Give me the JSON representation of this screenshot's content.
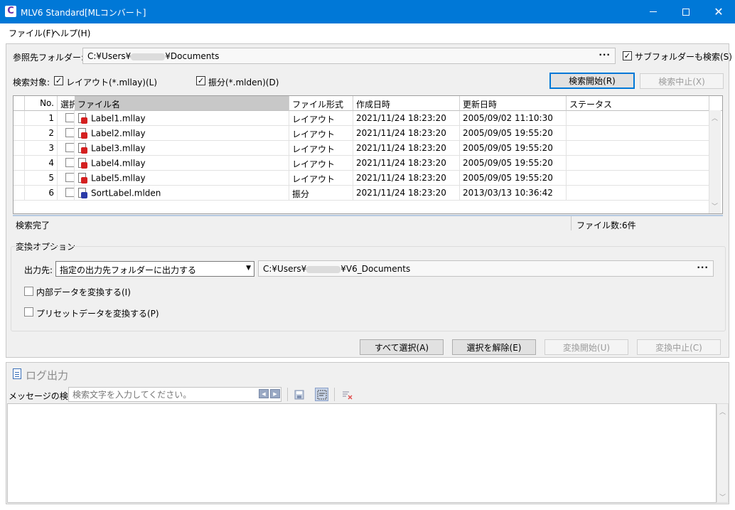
{
  "window": {
    "title": "MLV6 Standard[MLコンバート]",
    "app_icon_letter": "C"
  },
  "menu": {
    "items": [
      "ファイル(F)",
      "ヘルプ(H)"
    ]
  },
  "ref_folder": {
    "label": "参照先フォルダー:",
    "path_prefix": "C:¥Users¥",
    "path_suffix": "¥Documents",
    "browse": "···",
    "subfolder_label": "サブフォルダーも検索(S)",
    "subfolder_checked": true
  },
  "search_target": {
    "label": "検索対象:",
    "layout_label": "レイアウト(*.mllay)(L)",
    "layout_checked": true,
    "distribution_label": "振分(*.mlden)(D)",
    "distribution_checked": true,
    "start_button": "検索開始(R)",
    "stop_button": "検索中止(X)"
  },
  "grid": {
    "columns": [
      "No.",
      "選択",
      "ファイル名",
      "ファイル形式",
      "作成日時",
      "更新日時",
      "ステータス"
    ],
    "rows": [
      {
        "no": "1",
        "name": "Label1.mllay",
        "type": "レイアウト",
        "created": "2021/11/24 18:23:20",
        "updated": "2005/09/02 11:10:30",
        "status": "",
        "icon": "layout-file-icon"
      },
      {
        "no": "2",
        "name": "Label2.mllay",
        "type": "レイアウト",
        "created": "2021/11/24 18:23:20",
        "updated": "2005/09/05 19:55:20",
        "status": "",
        "icon": "layout-file-icon"
      },
      {
        "no": "3",
        "name": "Label3.mllay",
        "type": "レイアウト",
        "created": "2021/11/24 18:23:20",
        "updated": "2005/09/05 19:55:20",
        "status": "",
        "icon": "layout-file-icon"
      },
      {
        "no": "4",
        "name": "Label4.mllay",
        "type": "レイアウト",
        "created": "2021/11/24 18:23:20",
        "updated": "2005/09/05 19:55:20",
        "status": "",
        "icon": "layout-file-icon"
      },
      {
        "no": "5",
        "name": "Label5.mllay",
        "type": "レイアウト",
        "created": "2021/11/24 18:23:20",
        "updated": "2005/09/05 19:55:20",
        "status": "",
        "icon": "layout-file-icon"
      },
      {
        "no": "6",
        "name": "SortLabel.mlden",
        "type": "振分",
        "created": "2021/11/24 18:23:20",
        "updated": "2013/03/13 10:36:42",
        "status": "",
        "icon": "distribution-file-icon"
      }
    ]
  },
  "status": {
    "left": "検索完了",
    "right": "ファイル数:6件"
  },
  "options": {
    "group_label": "変換オプション",
    "output_label": "出力先:",
    "output_select": "指定の出力先フォルダーに出力する",
    "output_path_prefix": "C:¥Users¥",
    "output_path_suffix": "¥V6_Documents",
    "browse": "···",
    "internal_label": "内部データを変換する(I)",
    "preset_label": "プリセットデータを変換する(P)"
  },
  "actions": {
    "select_all": "すべて選択(A)",
    "deselect": "選択を解除(E)",
    "convert_start": "変換開始(U)",
    "convert_stop": "変換中止(C)"
  },
  "log": {
    "title": "ログ出力",
    "search_label": "メッセージの検索:",
    "search_placeholder": "検索文字を入力してください。"
  }
}
